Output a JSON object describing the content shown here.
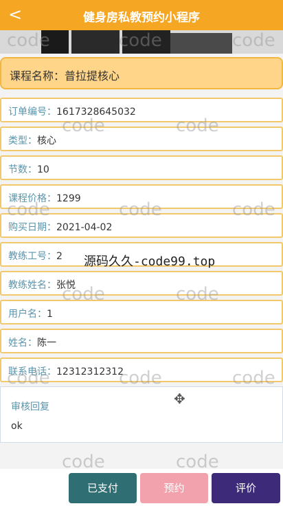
{
  "header": {
    "back": "<",
    "title": "健身房私教预约小程序"
  },
  "course": {
    "label": "课程名称：",
    "value": "普拉提核心"
  },
  "details": [
    {
      "key": "订单编号：",
      "value": "1617328645032"
    },
    {
      "key": "类型：",
      "value": "核心"
    },
    {
      "key": "节数：",
      "value": "10"
    },
    {
      "key": "课程价格：",
      "value": "1299"
    },
    {
      "key": "购买日期：",
      "value": "2021-04-02"
    },
    {
      "key": "教练工号：",
      "value": "2"
    },
    {
      "key": "教练姓名：",
      "value": "张悦"
    },
    {
      "key": "用户名：",
      "value": "1"
    },
    {
      "key": "姓名：",
      "value": "陈一"
    },
    {
      "key": "联系电话：",
      "value": "12312312312"
    }
  ],
  "review": {
    "label": "审核回复",
    "value": "ok"
  },
  "buttons": {
    "paid": "已支付",
    "book": "预约",
    "rate": "评价"
  },
  "watermark": {
    "word": "code",
    "site": "源码久久-code99.top"
  },
  "icons": {
    "back": "chevron-left-icon",
    "move": "move-icon"
  },
  "colors": {
    "header": "#f5a623",
    "paid": "#2f6e73",
    "book": "#f2a2ac",
    "rate": "#3d2b7a"
  }
}
